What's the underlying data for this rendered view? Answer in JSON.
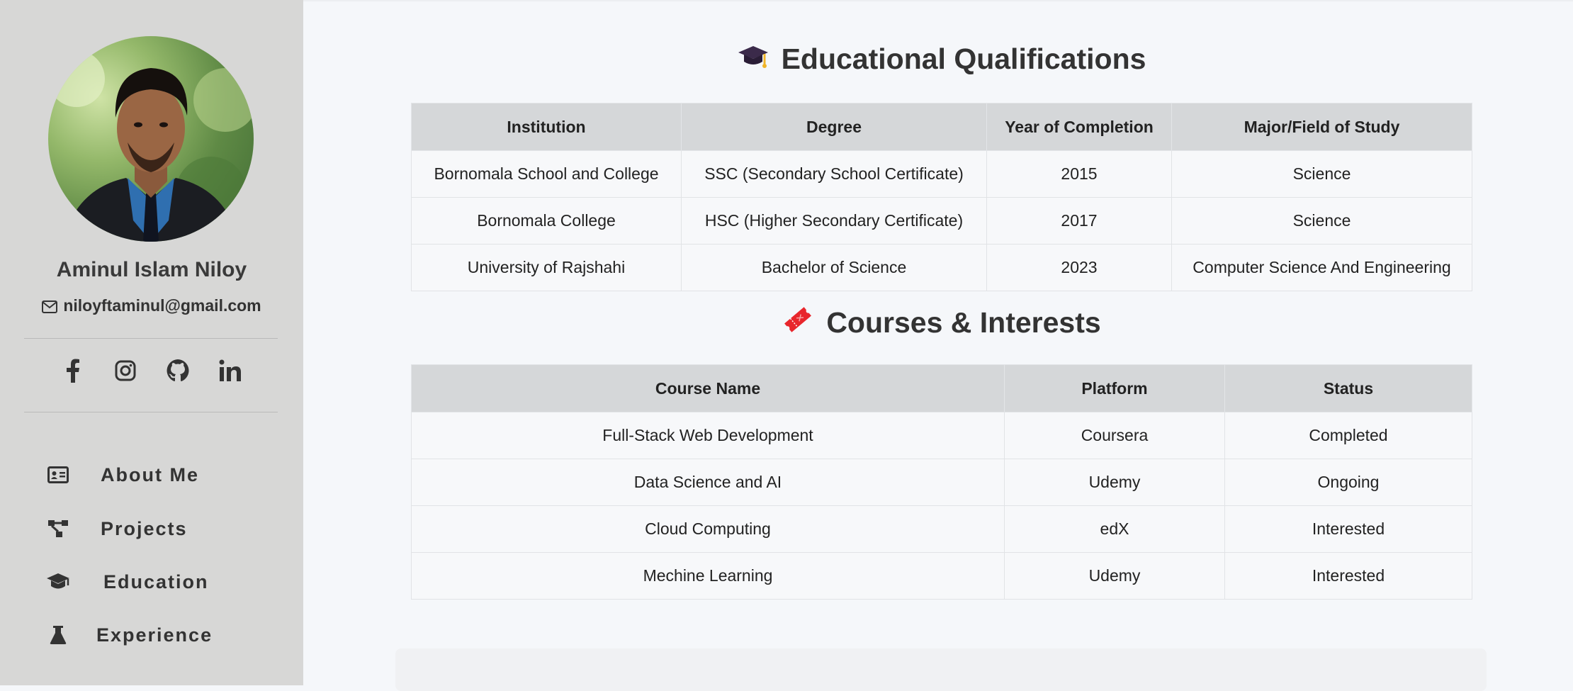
{
  "sidebar": {
    "name": "Aminul Islam Niloy",
    "email": "niloyftaminul@gmail.com",
    "socials": [
      "facebook-icon",
      "instagram-icon",
      "github-icon",
      "linkedin-icon"
    ],
    "nav": [
      {
        "label": "About Me",
        "icon": "id-card-icon"
      },
      {
        "label": "Projects",
        "icon": "project-diagram-icon"
      },
      {
        "label": "Education",
        "icon": "graduation-cap-icon"
      },
      {
        "label": "Experience",
        "icon": "flask-icon"
      }
    ]
  },
  "education": {
    "title": "Educational Qualifications",
    "icon": "graduation-cap-icon",
    "headers": [
      "Institution",
      "Degree",
      "Year of Completion",
      "Major/Field of Study"
    ],
    "rows": [
      [
        "Bornomala School and College",
        "SSC (Secondary School Certificate)",
        "2015",
        "Science"
      ],
      [
        "Bornomala College",
        "HSC (Higher Secondary Certificate)",
        "2017",
        "Science"
      ],
      [
        "University of Rajshahi",
        "Bachelor of Science",
        "2023",
        "Computer Science And Engineering"
      ]
    ]
  },
  "courses": {
    "title": "Courses & Interests",
    "icon": "ticket-icon",
    "headers": [
      "Course Name",
      "Platform",
      "Status"
    ],
    "rows": [
      [
        "Full-Stack Web Development",
        "Coursera",
        "Completed"
      ],
      [
        "Data Science and AI",
        "Udemy",
        "Ongoing"
      ],
      [
        "Cloud Computing",
        "edX",
        "Interested"
      ],
      [
        "Mechine Learning",
        "Udemy",
        "Interested"
      ]
    ]
  },
  "colors": {
    "sidebar_bg": "#d7d7d6",
    "main_bg": "#f5f7fa",
    "table_header_bg": "#d5d7d9",
    "ticket_icon": "#e8262c",
    "cap_icon": "#3b2a4a"
  }
}
